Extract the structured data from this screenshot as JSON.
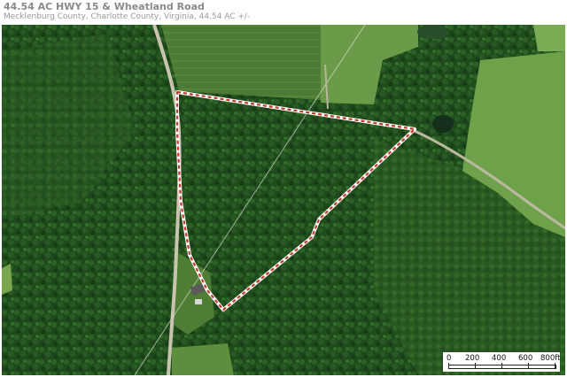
{
  "header": {
    "title": "44.54 AC HWY 15 & Wheatland Road",
    "subtitle": "Mecklenburg County, Charlotte County, Virginia, 44.54 AC +/-"
  },
  "map": {
    "type": "aerial-satellite",
    "parcel_boundary_color": "#ffffff",
    "parcel_boundary_dash_color": "#c0392b",
    "forest_color": "#1f4f1c",
    "field_color": "#5a8a3a",
    "road_color": "#c9c4b0"
  },
  "scale_bar": {
    "labels": [
      "0",
      "200",
      "400",
      "600",
      "800ft"
    ]
  }
}
